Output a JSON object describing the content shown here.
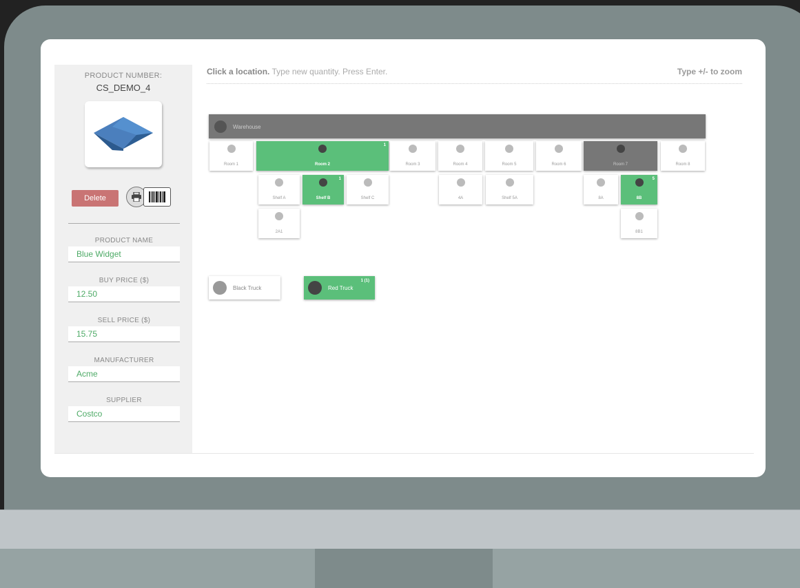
{
  "product": {
    "number_label": "PRODUCT NUMBER:",
    "number": "CS_DEMO_4",
    "delete_label": "Delete",
    "fields": [
      {
        "label": "PRODUCT NAME",
        "value": "Blue Widget"
      },
      {
        "label": "BUY PRICE ($)",
        "value": "12.50"
      },
      {
        "label": "SELL PRICE ($)",
        "value": "15.75"
      },
      {
        "label": "MANUFACTURER",
        "value": "Acme"
      },
      {
        "label": "SUPPLIER",
        "value": "Costco"
      }
    ]
  },
  "instructions": {
    "bold": "Click a location.",
    "rest": " Type new quantity. Press Enter.",
    "zoom": "Type +/- to zoom"
  },
  "warehouse": {
    "label": "Warehouse"
  },
  "rooms": [
    {
      "label": "Room 1",
      "qty": ""
    },
    {
      "label": "Room 2",
      "qty": "1"
    },
    {
      "label": "Room 3",
      "qty": ""
    },
    {
      "label": "Room 4",
      "qty": ""
    },
    {
      "label": "Room 5",
      "qty": ""
    },
    {
      "label": "Room 6",
      "qty": ""
    },
    {
      "label": "Room 7",
      "qty": ""
    },
    {
      "label": "Room 8",
      "qty": ""
    }
  ],
  "shelves": [
    {
      "label": "Shelf A",
      "qty": ""
    },
    {
      "label": "Shelf B",
      "qty": "1"
    },
    {
      "label": "Shelf C",
      "qty": ""
    },
    {
      "label": "4A",
      "qty": ""
    },
    {
      "label": "Shelf 5A",
      "qty": ""
    },
    {
      "label": "8A",
      "qty": ""
    },
    {
      "label": "8B",
      "qty": "5"
    }
  ],
  "sub_shelves": [
    {
      "label": "2A1"
    },
    {
      "label": "8B1"
    }
  ],
  "trucks": [
    {
      "label": "Black Truck",
      "qty": ""
    },
    {
      "label": "Red Truck",
      "qty": "1 (1)"
    }
  ],
  "colors": {
    "accent_green": "#5bbf7a",
    "delete_red": "#c97474",
    "product_blue": "#3c6aa0"
  }
}
